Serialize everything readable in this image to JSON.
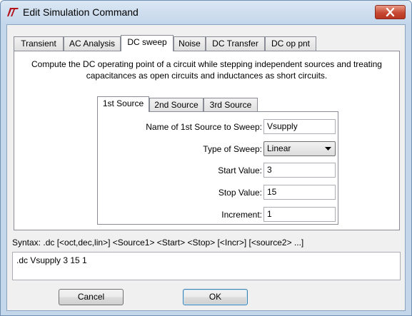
{
  "window": {
    "title": "Edit Simulation Command"
  },
  "tabs": [
    {
      "label": "Transient"
    },
    {
      "label": "AC Analysis"
    },
    {
      "label": "DC sweep"
    },
    {
      "label": "Noise"
    },
    {
      "label": "DC Transfer"
    },
    {
      "label": "DC op pnt"
    }
  ],
  "active_tab": "DC sweep",
  "dc_sweep": {
    "description_line1": "Compute the DC operating point of a circuit while stepping independent sources and treating",
    "description_line2": "capacitances as open circuits and inductances as short circuits.",
    "source_tabs": [
      {
        "label": "1st Source"
      },
      {
        "label": "2nd Source"
      },
      {
        "label": "3rd Source"
      }
    ],
    "active_source_tab": "1st Source",
    "fields": {
      "source_name_label": "Name of 1st Source to Sweep:",
      "source_name_value": "Vsupply",
      "sweep_type_label": "Type of Sweep:",
      "sweep_type_value": "Linear",
      "start_label": "Start Value:",
      "start_value": "3",
      "stop_label": "Stop Value:",
      "stop_value": "15",
      "increment_label": "Increment:",
      "increment_value": "1"
    }
  },
  "syntax_text": "Syntax: .dc [<oct,dec,lin>] <Source1> <Start> <Stop> [<Incr>] [<source2> ...]",
  "command_text": ".dc Vsupply 3 15 1",
  "buttons": {
    "cancel_label": "Cancel",
    "ok_label": "OK"
  },
  "icons": {
    "app": "ltspice-logo-icon",
    "close": "close-icon",
    "dropdown": "chevron-down-icon"
  },
  "colors": {
    "title_bar": "#c4d6ea",
    "close_button": "#c74a33",
    "logo": "#b3121a"
  }
}
